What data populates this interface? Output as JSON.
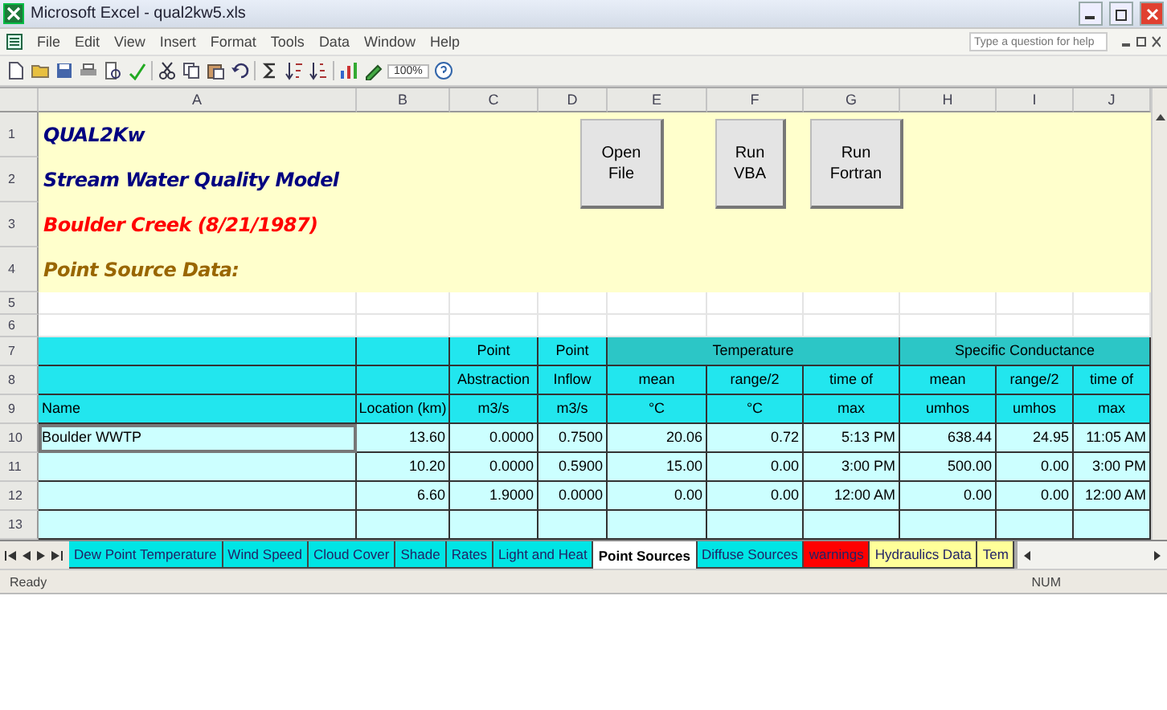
{
  "window": {
    "title": "Microsoft Excel - qual2kw5.xls"
  },
  "menu": [
    "File",
    "Edit",
    "View",
    "Insert",
    "Format",
    "Tools",
    "Data",
    "Window",
    "Help"
  ],
  "help_field": {
    "placeholder": "Type a question for help"
  },
  "toolbar": {
    "zoom": "100%"
  },
  "sheet": {
    "column_letters": [
      "A",
      "B",
      "C",
      "D",
      "E",
      "F",
      "G",
      "H",
      "I",
      "J"
    ],
    "row_numbers": [
      "1",
      "2",
      "3",
      "4",
      "5",
      "6",
      "7",
      "8",
      "9",
      "10",
      "11",
      "12",
      "13"
    ],
    "titles": [
      {
        "text": "QUAL2Kw",
        "color": "#000080"
      },
      {
        "text": "Stream Water Quality Model",
        "color": "#000080"
      },
      {
        "text": "Boulder Creek (8/21/1987)",
        "color": "#ff0000"
      },
      {
        "text": "Point Source Data:",
        "color": "#996600"
      }
    ],
    "buttons": [
      {
        "lines": [
          "Open",
          "File"
        ]
      },
      {
        "lines": [
          "Run",
          "VBA"
        ]
      },
      {
        "lines": [
          "Run",
          "Fortran"
        ]
      }
    ],
    "table": {
      "columns": [
        {
          "heading": [
            "Name"
          ]
        },
        {
          "heading": [
            "Location (km)"
          ]
        },
        {
          "heading": [
            "Point",
            "Abstraction",
            "m3/s"
          ]
        },
        {
          "heading": [
            "Point",
            "Inflow",
            "m3/s"
          ]
        }
      ],
      "groups": [
        {
          "label": "Temperature",
          "columns": [
            {
              "heading": [
                "mean",
                "°C"
              ]
            },
            {
              "heading": [
                "range/2",
                "°C"
              ]
            },
            {
              "heading": [
                "time of",
                "max"
              ]
            }
          ]
        },
        {
          "label": "Specific Conductance",
          "columns": [
            {
              "heading": [
                "mean",
                "umhos"
              ]
            },
            {
              "heading": [
                "range/2",
                "umhos"
              ]
            },
            {
              "heading": [
                "time of",
                "max"
              ]
            }
          ]
        }
      ],
      "rows": [
        {
          "selected": true,
          "cells": [
            "Boulder WWTP",
            "13.60",
            "0.0000",
            "0.7500",
            "20.06",
            "0.72",
            "5:13 PM",
            "638.44",
            "24.95",
            "11:05 AM"
          ]
        },
        {
          "selected": false,
          "cells": [
            "",
            "10.20",
            "0.0000",
            "0.5900",
            "15.00",
            "0.00",
            "3:00 PM",
            "500.00",
            "0.00",
            "3:00 PM"
          ]
        },
        {
          "selected": false,
          "cells": [
            "",
            "6.60",
            "1.9000",
            "0.0000",
            "0.00",
            "0.00",
            "12:00 AM",
            "0.00",
            "0.00",
            "12:00 AM"
          ]
        }
      ]
    }
  },
  "tabs": [
    {
      "label": "Dew Point Temperature",
      "selected": false,
      "color": "#00e5e5"
    },
    {
      "label": "Wind Speed",
      "selected": false,
      "color": "#00e5e5"
    },
    {
      "label": "Cloud Cover",
      "selected": false,
      "color": "#00e5e5"
    },
    {
      "label": "Shade",
      "selected": false,
      "color": "#00e5e5"
    },
    {
      "label": "Rates",
      "selected": false,
      "color": "#00e5e5"
    },
    {
      "label": "Light and Heat",
      "selected": false,
      "color": "#00e5e5"
    },
    {
      "label": "Point Sources",
      "selected": true,
      "color": "#ffffff"
    },
    {
      "label": "Diffuse Sources",
      "selected": false,
      "color": "#00e5e5"
    },
    {
      "label": "warnings",
      "selected": false,
      "color": "#ff0000"
    },
    {
      "label": "Hydraulics Data",
      "selected": false,
      "color": "#ffff99"
    },
    {
      "label": "Tem",
      "selected": false,
      "color": "#ffff99"
    }
  ],
  "status_bar": {
    "left": "Ready",
    "right": "NUM"
  }
}
